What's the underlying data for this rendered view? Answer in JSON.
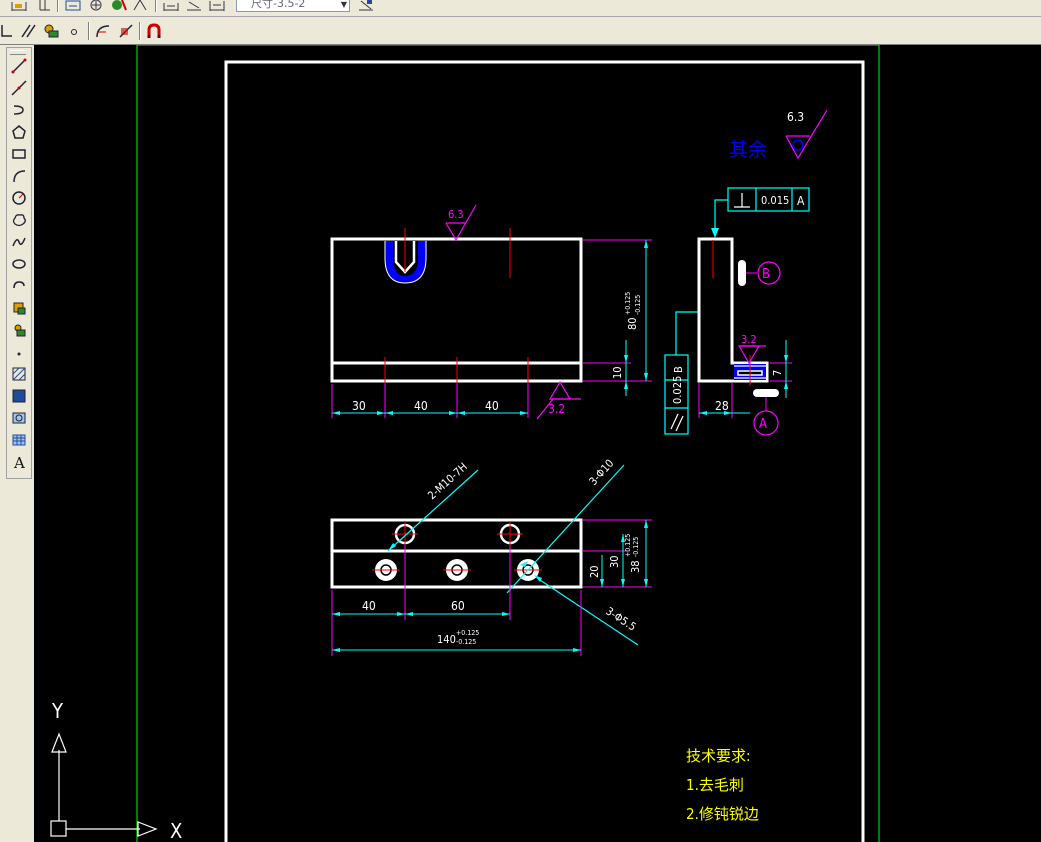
{
  "toolbar": {
    "dim_style_value": "尺寸-3.5-2"
  },
  "drawing": {
    "roughness_other_label": "其余",
    "roughness_general": "6.3",
    "roughness_top": "6.3",
    "roughness_bottom": "3.2",
    "roughness_side": "3.2",
    "flatness_tolerance": "0.015",
    "flatness_datum": "A",
    "parallel_tolerance": "0.025",
    "parallel_datum": "B",
    "datum_b": "B",
    "datum_a": "A",
    "dim_30": "30",
    "dim_40a": "40",
    "dim_40b": "40",
    "dim_80": "80",
    "dim_80_tol_upper": "+0.125",
    "dim_80_tol_lower": "-0.125",
    "dim_10": "10",
    "dim_28": "28",
    "dim_7": "7",
    "dim_40c": "40",
    "dim_60": "60",
    "dim_140": "140",
    "dim_140_tol_upper": "+0.125",
    "dim_140_tol_lower": "-0.125",
    "dim_20": "20",
    "dim_30b": "30",
    "dim_38": "38",
    "dim_38_tol_upper": "+0.125",
    "dim_38_tol_lower": "-0.125",
    "thread_callout": "2-M10-7H",
    "hole_callout_10": "3-Φ10",
    "hole_callout_55": "3-Φ5.5",
    "tech_req_title": "技术要求:",
    "tech_req_1": "1.去毛刺",
    "tech_req_2": "2.修钝锐边"
  },
  "ucs": {
    "x_label": "X",
    "y_label": "Y"
  },
  "colors": {
    "toolbar_bg": "#ece9d8",
    "canvas_bg": "#000000",
    "outline": "#ffffff",
    "dimension": "#00ffff",
    "roughness": "#ff00ff",
    "centerline": "#ff0000",
    "hatch": "#0000ff",
    "tech_text": "#ffff00",
    "paper_border": "#00ff00"
  }
}
